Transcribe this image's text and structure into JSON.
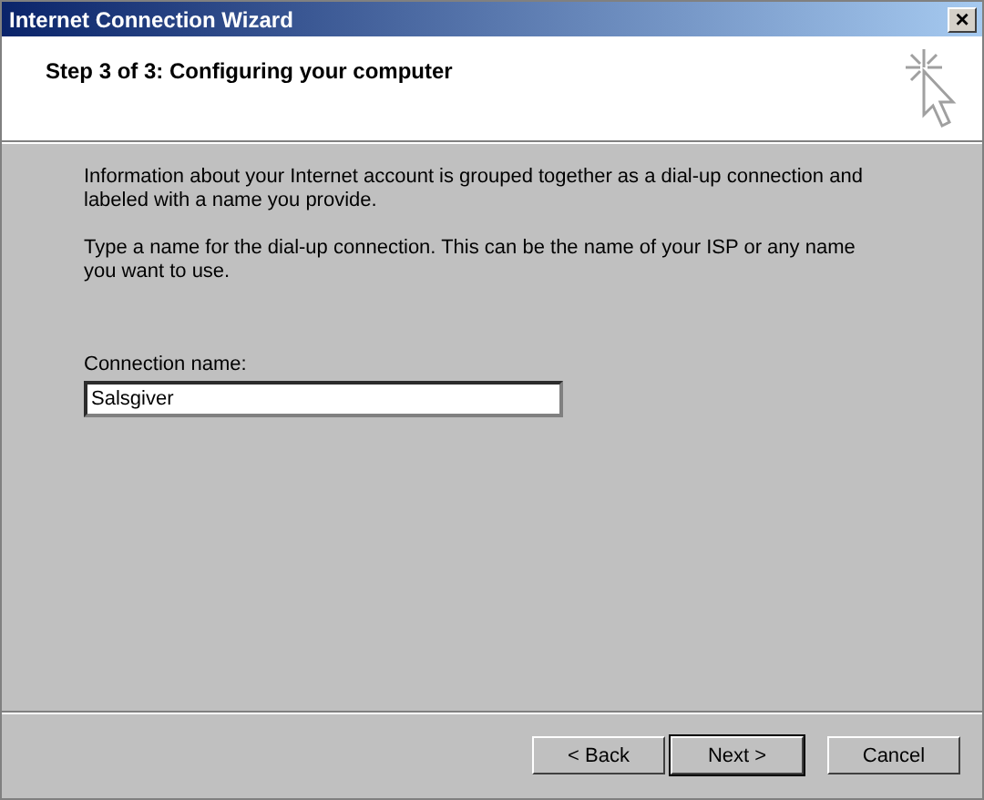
{
  "window": {
    "title": "Internet Connection Wizard",
    "close": "×"
  },
  "header": {
    "title": "Step 3 of 3: Configuring your computer"
  },
  "paragraphs": [
    "Information about your Internet account is grouped together as a dial-up connection and labeled with a name you provide.",
    "Type a name for the dial-up connection. This can be the name of your ISP or any name you want to use."
  ],
  "field": {
    "label": "Connection name:",
    "value": "Salsgiver"
  },
  "buttons": [
    {
      "label": "< Back",
      "default": false
    },
    {
      "label": "Next >",
      "default": true
    },
    {
      "label": "Cancel",
      "default": false
    }
  ]
}
